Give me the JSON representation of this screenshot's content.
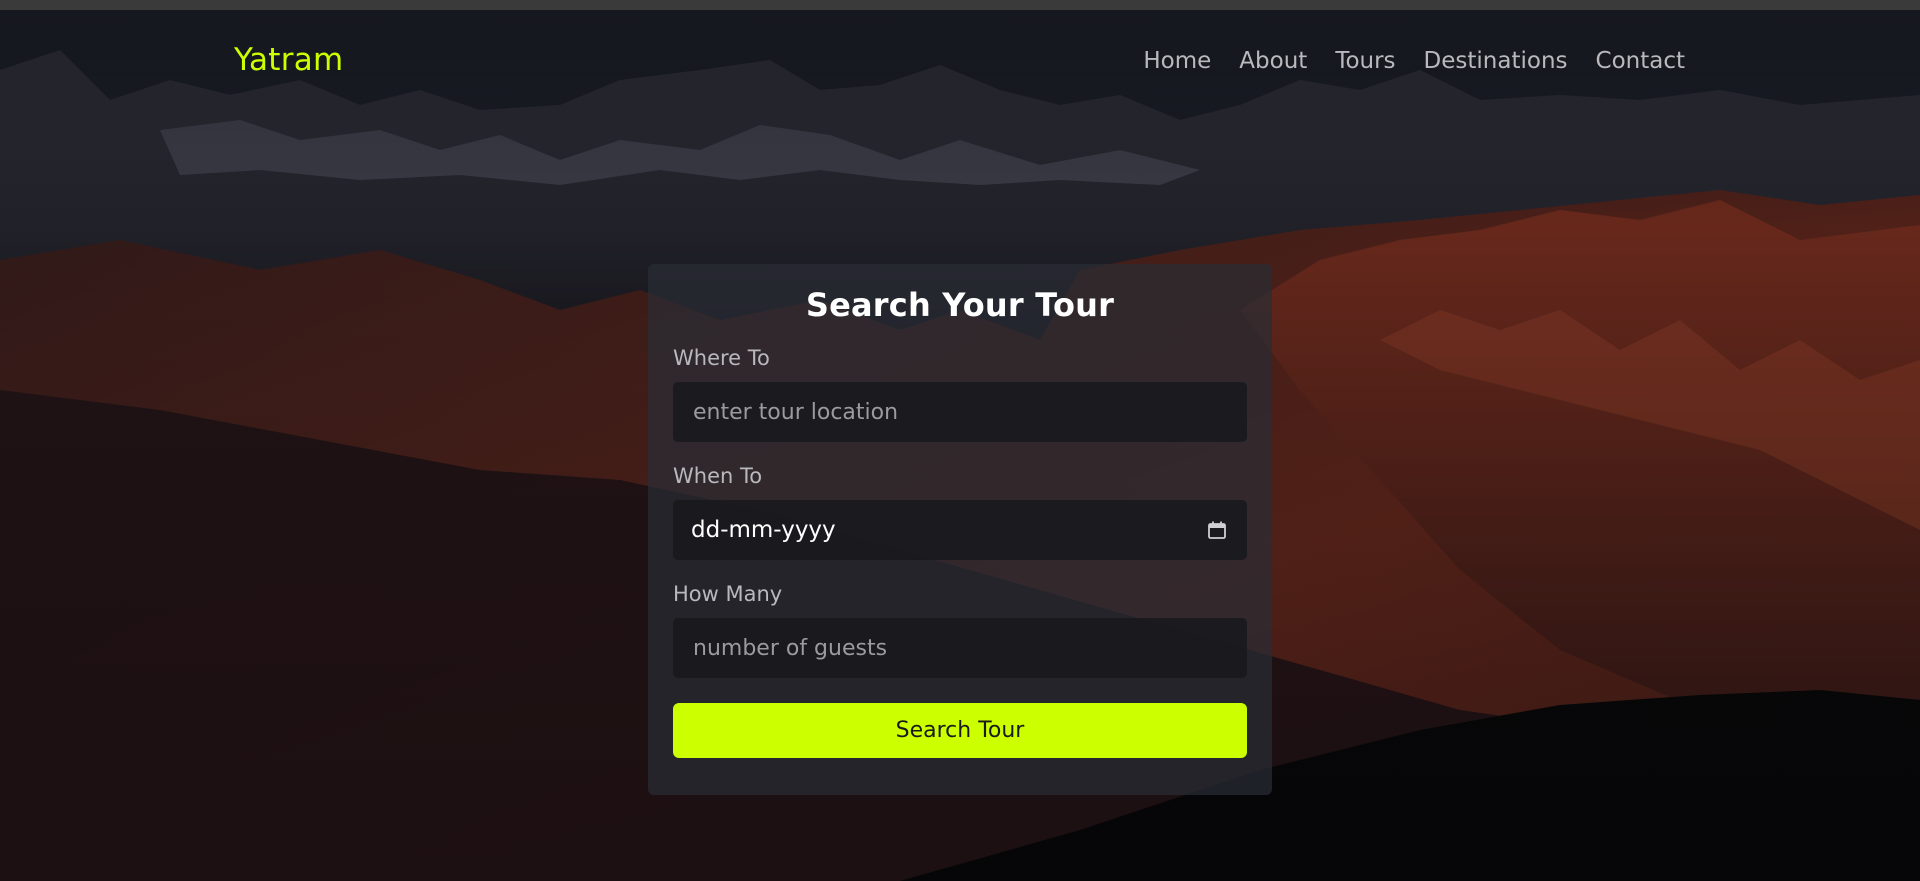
{
  "brand": "Yatram",
  "nav": {
    "items": [
      "Home",
      "About",
      "Tours",
      "Destinations",
      "Contact"
    ]
  },
  "search": {
    "title": "Search Your Tour",
    "where_label": "Where To",
    "where_placeholder": "enter tour location",
    "when_label": "When To",
    "when_value": "dd-mm-yyyy",
    "how_many_label": "How Many",
    "how_many_placeholder": "number of guests",
    "submit_label": "Search Tour"
  },
  "colors": {
    "accent": "#ccff00",
    "nav_text": "#b9b9bd",
    "card_bg": "#2a2c34"
  },
  "icons": {
    "date_picker": "calendar-icon"
  }
}
